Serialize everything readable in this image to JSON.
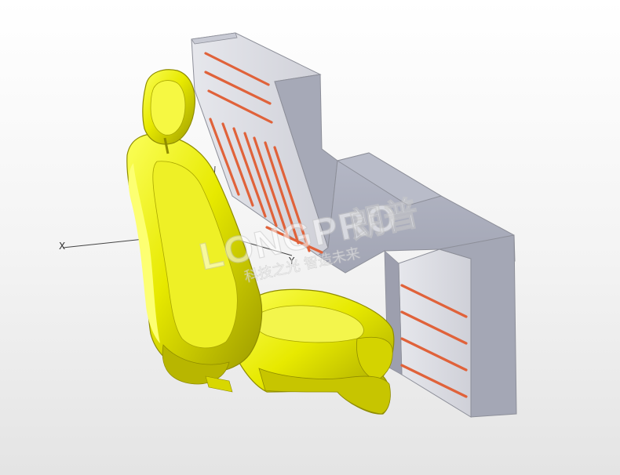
{
  "viewport": {
    "axes": {
      "x_label": "X",
      "y_label": "Y"
    },
    "watermark": {
      "brand_latin": "LONGPRO",
      "brand_cn": "朗普",
      "slogan": "科技之光 智造未来"
    },
    "colors": {
      "seat": "#e6e80e",
      "panel": "#a9acb8",
      "heater_rod": "#e0623a"
    }
  }
}
